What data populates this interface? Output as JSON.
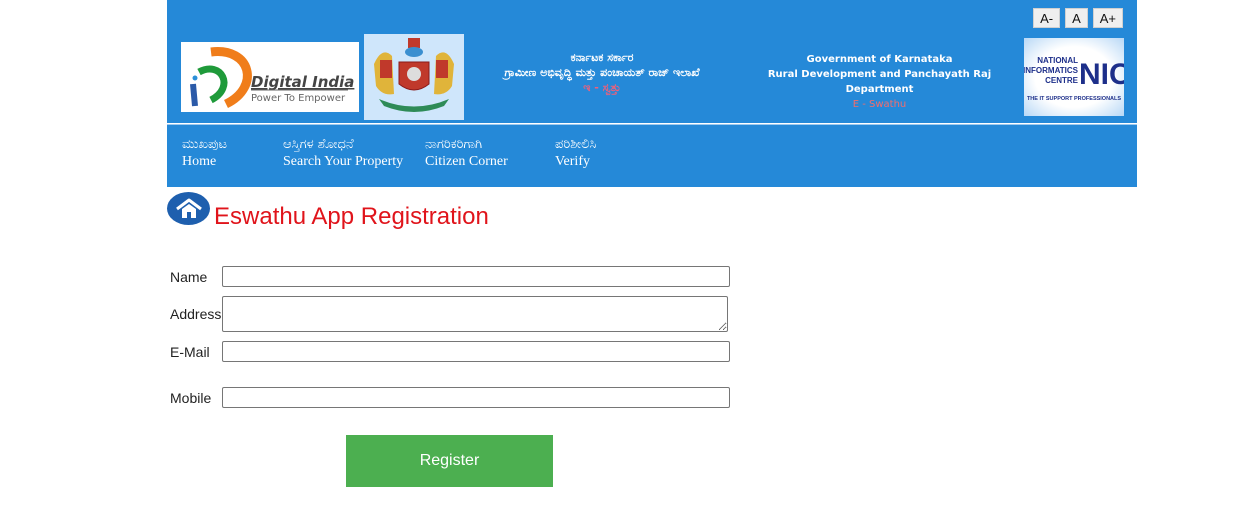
{
  "header": {
    "font_controls": [
      "A-",
      "A",
      "A+"
    ],
    "logos": {
      "digital_india": {
        "title": "Digital India",
        "tagline": "Power To Empower"
      },
      "emblem": "Karnataka state emblem",
      "nic": {
        "lines": [
          "NATIONAL",
          "INFORMATICS",
          "CENTRE"
        ],
        "mark": "NIC",
        "tagline": "THE IT SUPPORT PROFESSIONALS"
      }
    },
    "kannada": {
      "line1": "ಕರ್ನಾಟಕ ಸರ್ಕಾರ",
      "line2": "ಗ್ರಾಮೀಣ ಅಭಿವೃದ್ಧಿ ಮತ್ತು ಪಂಚಾಯತ್ ರಾಜ್ ಇಲಾಖೆ",
      "line3": "ಇ - ಸ್ವತ್ತು"
    },
    "english": {
      "line1": "Government of Karnataka",
      "line2": "Rural Development and Panchayath Raj Department",
      "line3": "E - Swathu"
    }
  },
  "nav": [
    {
      "kn": "ಮುಖಪುಟ",
      "en": "Home"
    },
    {
      "kn": "ಆಸ್ತಿಗಳ ಶೋಧನೆ",
      "en": "Search Your Property"
    },
    {
      "kn": "ನಾಗರಿಕರಿಗಾಗಿ",
      "en": "Citizen Corner"
    },
    {
      "kn": "ಪರಿಶೀಲಿಸಿ",
      "en": "Verify"
    }
  ],
  "page": {
    "title": "Eswathu App Registration"
  },
  "form": {
    "name_label": "Name",
    "name_value": "",
    "address_label": "Address",
    "address_value": "",
    "email_label": "E-Mail",
    "email_value": "",
    "mobile_label": "Mobile",
    "mobile_value": "",
    "register_label": "Register"
  },
  "colors": {
    "header_blue": "#2589d8",
    "title_red": "#e0141b",
    "register_green": "#4caf50"
  }
}
